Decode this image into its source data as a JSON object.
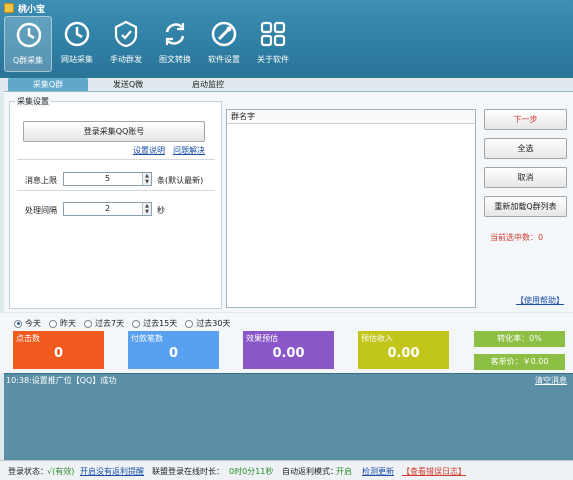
{
  "window": {
    "title": "桃小宝"
  },
  "toolbar": [
    {
      "label": "Q群采集",
      "icon": "qq-collect-icon"
    },
    {
      "label": "网站采集",
      "icon": "web-collect-icon"
    },
    {
      "label": "手动群发",
      "icon": "hand-send-icon"
    },
    {
      "label": "图文转换",
      "icon": "convert-icon"
    },
    {
      "label": "软件设置",
      "icon": "settings-icon"
    },
    {
      "label": "关于软件",
      "icon": "about-icon"
    }
  ],
  "tabs": [
    "采集Q群",
    "发送Q微",
    "启动监控"
  ],
  "settings": {
    "legend": "采集设置",
    "login_button": "登录采集QQ账号",
    "link_setting": "设置说明",
    "link_problem": "问题解决",
    "limit_label": "消息上限",
    "limit_value": "5",
    "limit_unit": "条(默认最新)",
    "interval_label": "处理间隔",
    "interval_value": "2",
    "interval_unit": "秒"
  },
  "group_list": {
    "header": "群名字"
  },
  "actions": {
    "next": "下一步",
    "select_all": "全选",
    "cancel": "取消",
    "reload": "重新加载Q群列表",
    "selected_label": "当前选中数：",
    "selected_count": "0",
    "help": "【使用帮助】"
  },
  "colors": {
    "next_text": "#d43a2c",
    "card_clicks": "#f05a1e",
    "card_pays": "#5aa0f0",
    "card_effect": "#8a57c9",
    "card_income": "#c2c51a",
    "mini": "#8cbf43"
  },
  "periods": [
    {
      "label": "今天",
      "selected": true
    },
    {
      "label": "昨天",
      "selected": false
    },
    {
      "label": "过去7天",
      "selected": false
    },
    {
      "label": "过去15天",
      "selected": false
    },
    {
      "label": "过去30天",
      "selected": false
    }
  ],
  "cards": [
    {
      "title": "点击数",
      "value": "0"
    },
    {
      "title": "付款笔数",
      "value": "0"
    },
    {
      "title": "效果预估",
      "value": "0.00"
    },
    {
      "title": "预估收入",
      "value": "0.00"
    }
  ],
  "mini": {
    "conversion": "转化率：0%",
    "unit_price": "客单价：￥0.00"
  },
  "log": {
    "line": "10:38:设置推广位【QQ】成功",
    "clear": "清空消息"
  },
  "status": {
    "login_label": "登录状态：",
    "login_value": "√(有效)",
    "remind": "开启没有返利提醒",
    "online_label": "联盟登录在线时长：",
    "online_value": "0时0分11秒",
    "auto_label": "自动返利模式：",
    "auto_value": "开启",
    "update": "检测更新",
    "errlog": "【查看错误日志】"
  }
}
